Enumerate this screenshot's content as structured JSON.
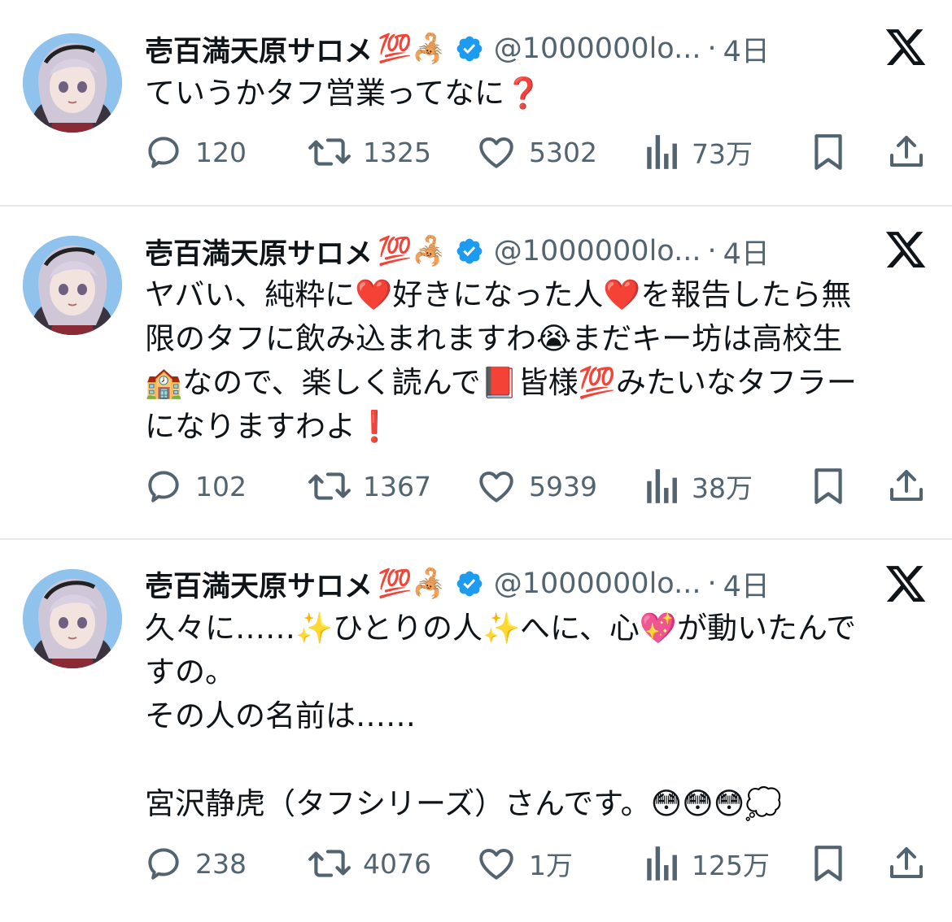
{
  "user": {
    "name": "壱百満天原サロメ",
    "name_emojis": "💯🦂",
    "handle": "@1000000lo...",
    "dot": "·"
  },
  "colors": {
    "verified": "#1d9bf0",
    "muted": "#536471",
    "divider": "#e6e9ec"
  },
  "tweets": [
    {
      "time": "4日",
      "text": "ていうかタフ営業ってなに❓",
      "replies": "120",
      "retweets": "1325",
      "likes": "5302",
      "views": "73万"
    },
    {
      "time": "4日",
      "text": "ヤバい、純粋に❤️好きになった人❤️を報告したら無\n限のタフに飲み込まれますわ😭まだキー坊は高校生\n🏫なので、楽しく読んで📕皆様💯みたいなタフラー\nになりますわよ❗️",
      "replies": "102",
      "retweets": "1367",
      "likes": "5939",
      "views": "38万"
    },
    {
      "time": "4日",
      "text": "久々に……✨ひとりの人✨へに、心💖が動いたんで\nすの。\nその人の名前は……\n\n宮沢静虎（タフシリーズ）さんです。😳😳😳💭",
      "replies": "238",
      "retweets": "4076",
      "likes": "1万",
      "views": "125万"
    }
  ],
  "icons": {
    "reply": "speech-bubble-icon",
    "retweet": "retweet-arrows-icon",
    "like": "heart-icon",
    "views": "bar-chart-icon",
    "bookmark": "bookmark-icon",
    "share": "share-upload-icon",
    "brand": "x-logo-icon",
    "verified": "verified-badge-icon"
  }
}
